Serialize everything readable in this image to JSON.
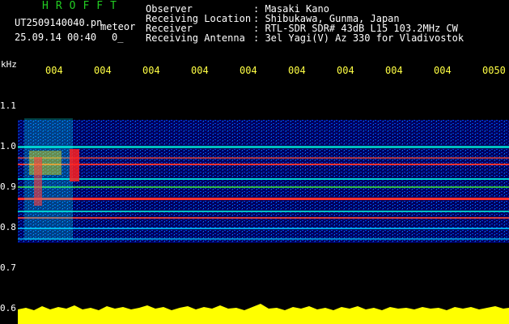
{
  "header": {
    "logo": "HROFFT",
    "filename": "UT2509140040.pn",
    "mode": "meteor",
    "datetime": "25.09.14 00:40",
    "counter": "0_",
    "info": [
      {
        "label": "Observer",
        "value": ": Masaki Kano"
      },
      {
        "label": "Receiving Location",
        "value": ": Shibukawa, Gunma, Japan"
      },
      {
        "label": "Receiver",
        "value": ": RTL-SDR SDR# 43dB L15 103.2MHz CW"
      },
      {
        "label": "Receiving Antenna",
        "value": ": 3el Yagi(V) Az 330 for Vladivostok"
      }
    ]
  },
  "axis": {
    "unit": "kHz",
    "y_ticks": [
      "1.1",
      "1.0",
      "0.9",
      "0.8",
      "0.7",
      "0.6"
    ],
    "x_ticks": [
      "004",
      "004",
      "004",
      "004",
      "004",
      "004",
      "004",
      "004",
      "004",
      "0050"
    ]
  },
  "colors": {
    "background": "#000000",
    "logo": "#22cc22",
    "ticks": "#ffff44",
    "signal": "#ff3030"
  }
}
